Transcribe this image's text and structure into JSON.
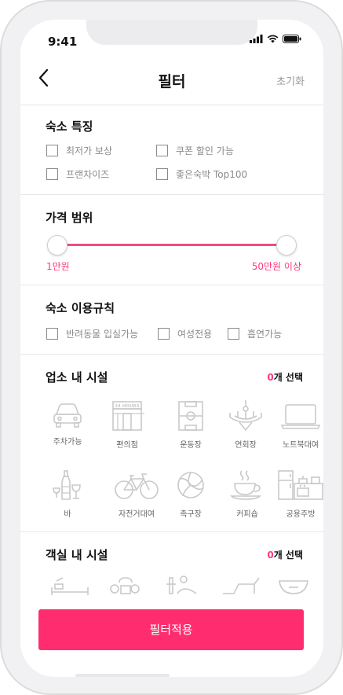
{
  "status": {
    "time": "9:41"
  },
  "nav": {
    "title": "필터",
    "reset_label": "초기화"
  },
  "features": {
    "title": "숙소 특징",
    "options": [
      "최저가 보상",
      "쿠폰 할인 가능",
      "프랜차이즈",
      "좋은숙박 Top100"
    ]
  },
  "price": {
    "title": "가격 범위",
    "min_label": "1만원",
    "max_label": "50만원 이상",
    "range_fraction": [
      0,
      1
    ]
  },
  "rules": {
    "title": "숙소 이용규칙",
    "options": [
      "반려동물 입실가능",
      "여성전용",
      "흡연가능"
    ]
  },
  "facilities": {
    "title": "업소 내 시설",
    "count_num": "0",
    "count_suffix": "개 선택",
    "items": [
      {
        "label": "주차가능",
        "icon": "car-icon"
      },
      {
        "label": "편의점",
        "icon": "convenience-store-icon"
      },
      {
        "label": "운동장",
        "icon": "field-icon"
      },
      {
        "label": "연회장",
        "icon": "chandelier-icon"
      },
      {
        "label": "노트북대여",
        "icon": "laptop-icon"
      },
      {
        "label": "바",
        "icon": "wine-bar-icon"
      },
      {
        "label": "자전거대여",
        "icon": "bicycle-icon"
      },
      {
        "label": "족구장",
        "icon": "volleyball-icon"
      },
      {
        "label": "커피숍",
        "icon": "coffee-cup-icon"
      },
      {
        "label": "공용주방",
        "icon": "kitchen-icon"
      }
    ]
  },
  "room_facilities": {
    "title": "객실 내 시설",
    "count_num": "0",
    "count_suffix": "개 선택"
  },
  "apply": {
    "label": "필터적용"
  },
  "colors": {
    "accent": "#ff2d6f",
    "muted": "#8a8a8a"
  }
}
